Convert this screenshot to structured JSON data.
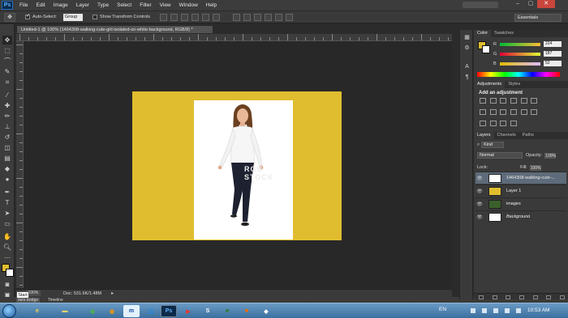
{
  "app": {
    "logo": "Ps"
  },
  "menu": [
    "File",
    "Edit",
    "Image",
    "Layer",
    "Type",
    "Select",
    "Filter",
    "View",
    "Window",
    "Help"
  ],
  "options_bar": {
    "auto_select_label": "Auto-Select:",
    "auto_select_value": "Group",
    "show_transform_label": "Show Transform Controls",
    "workspace": "Essentials"
  },
  "document": {
    "tab_title": "Untitled-1 @ 100% (1464308-walking-cute-girl-isolated-on-white-background, RGB/8) *",
    "zoom": "100%",
    "doc_info": "Doc: 531.6K/1.48M",
    "watermark": "RGB STOCK"
  },
  "bottom_tabs": [
    "Mini Bridge",
    "Timeline"
  ],
  "start_tooltip": "Start",
  "color_panel": {
    "tabs": [
      "Color",
      "Swatches"
    ],
    "channels": [
      {
        "label": "R",
        "value": "224"
      },
      {
        "label": "G",
        "value": "187"
      },
      {
        "label": "B",
        "value": "52"
      }
    ],
    "foreground": "#e0bb34",
    "background": "#ffffff"
  },
  "adjustments_panel": {
    "tabs": [
      "Adjustments",
      "Styles"
    ],
    "title": "Add an adjustment"
  },
  "layers_panel": {
    "tabs": [
      "Layers",
      "Channels",
      "Paths"
    ],
    "filter_kind": "Kind",
    "blend_mode": "Normal",
    "opacity_label": "Opacity:",
    "opacity": "100%",
    "lock_label": "Lock:",
    "fill_label": "Fill:",
    "fill": "100%",
    "layers": [
      {
        "name": "1464308-walking-cute-...",
        "selected": true,
        "thumb": "#ffffff"
      },
      {
        "name": "Layer 1",
        "selected": false,
        "thumb": "#e0bd2f"
      },
      {
        "name": "images",
        "selected": false,
        "thumb": "#3a5f2a"
      },
      {
        "name": "Background",
        "selected": false,
        "thumb": "#ffffff",
        "italic": true
      }
    ]
  },
  "taskbar": {
    "language": "EN",
    "time": "10:53 AM"
  },
  "colors": {
    "canvas_yellow": "#e0bd2f",
    "ui_dark": "#2b2b2b",
    "panel": "#3a3a3a",
    "taskbar": "#3b6f9e"
  }
}
